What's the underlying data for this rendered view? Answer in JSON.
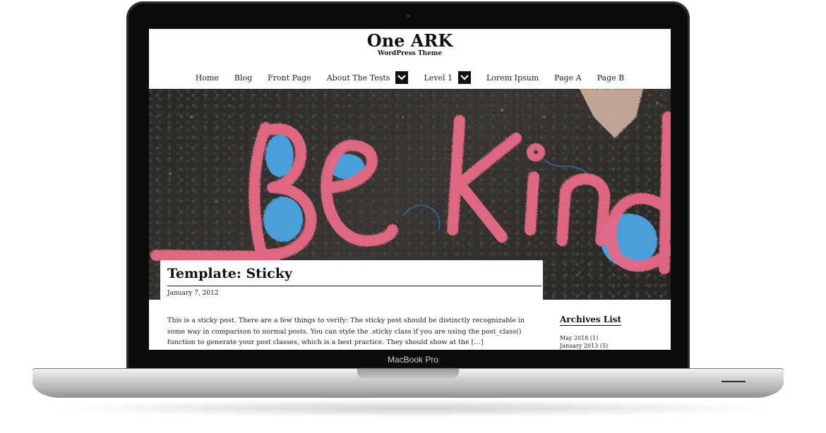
{
  "device": {
    "label": "MacBook Pro"
  },
  "site": {
    "title": "One ARK",
    "description": "WordPress Theme",
    "nav": [
      {
        "label": "Home",
        "has_dropdown": false
      },
      {
        "label": "Blog",
        "has_dropdown": false
      },
      {
        "label": "Front Page",
        "has_dropdown": false
      },
      {
        "label": "About The Tests",
        "has_dropdown": true
      },
      {
        "label": "Level 1",
        "has_dropdown": true
      },
      {
        "label": "Lorem Ipsum",
        "has_dropdown": false
      },
      {
        "label": "Page A",
        "has_dropdown": false
      },
      {
        "label": "Page B",
        "has_dropdown": false
      }
    ],
    "hero_text": "Be Kind"
  },
  "post": {
    "title": "Template: Sticky",
    "date": "January 7, 2012",
    "excerpt_lines": [
      "This is a sticky post. There are a few things to verify: The sticky post should be distinctly recognizable in",
      "some way in comparison to normal posts. You can style the .sticky class if you are using the post_class()",
      "function to generate your post classes, which is a best practice. They should show at the […]"
    ]
  },
  "sidebar": {
    "widget_title": "Archives List",
    "archives": [
      "May 2018 (1)",
      "January 2013 (5)"
    ]
  },
  "colors": {
    "chalk_pink": "#e86a86",
    "chalk_blue": "#4a9fd8",
    "asphalt": "#2f2d2a"
  }
}
